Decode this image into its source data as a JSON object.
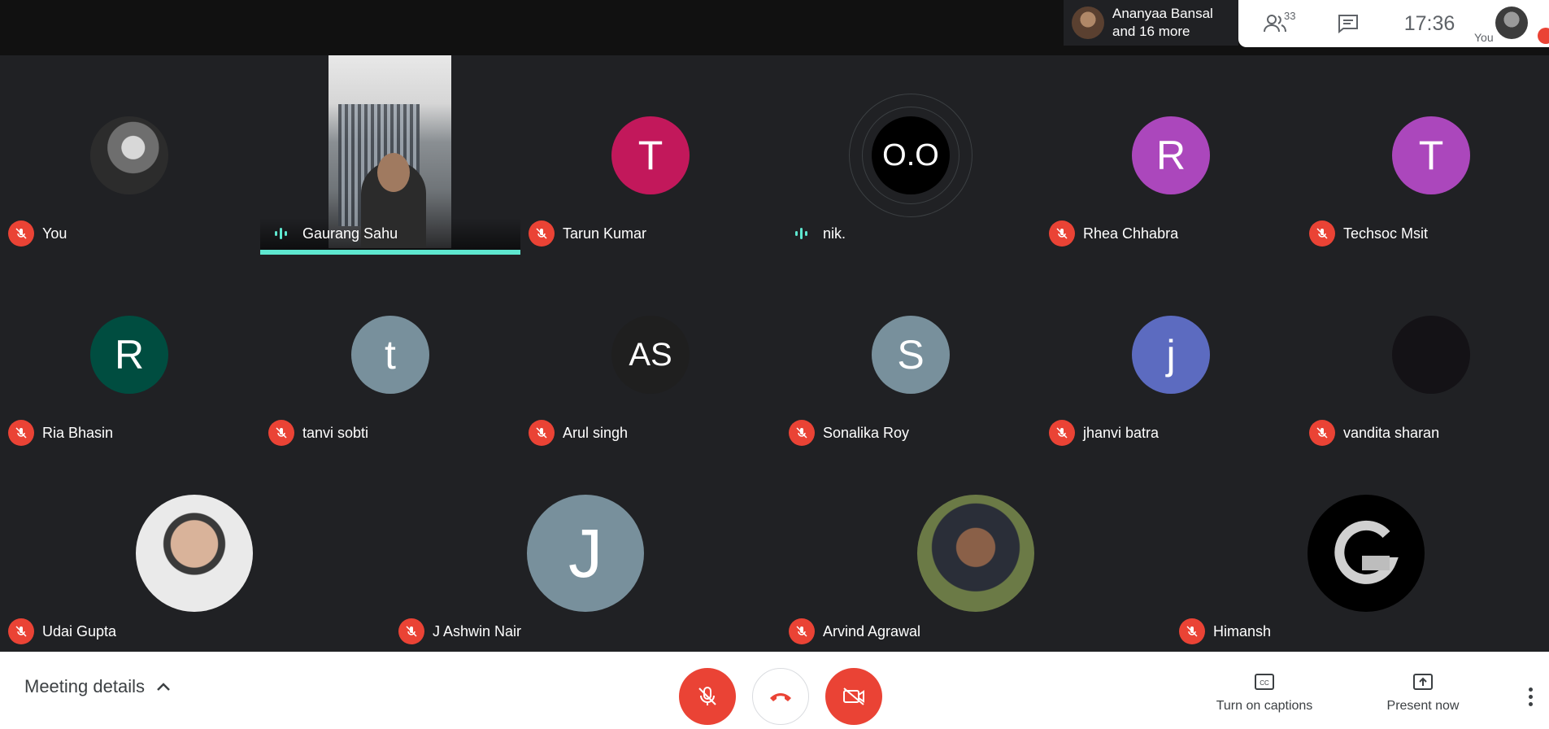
{
  "topbar": {
    "presence_text_line1": "Ananyaa Bansal",
    "presence_text_line2": "and 16 more",
    "people_count": "33",
    "clock": "17:36",
    "self_label": "You"
  },
  "participants": [
    {
      "name": "You",
      "initials": "",
      "muted": true,
      "color": "#555"
    },
    {
      "name": "Gaurang Sahu",
      "initials": "",
      "muted": false,
      "speaking": true
    },
    {
      "name": "Tarun Kumar",
      "initials": "T",
      "muted": true,
      "color": "#c2185b"
    },
    {
      "name": "nik.",
      "initials": "O.O",
      "muted": false,
      "speaking": true,
      "color": "#000000"
    },
    {
      "name": "Rhea Chhabra",
      "initials": "R",
      "muted": true,
      "color": "#ab47bc"
    },
    {
      "name": "Techsoc Msit",
      "initials": "T",
      "muted": true,
      "color": "#ab47bc"
    },
    {
      "name": "Ria Bhasin",
      "initials": "R",
      "muted": true,
      "color": "#004d40"
    },
    {
      "name": "tanvi sobti",
      "initials": "t",
      "muted": true,
      "color": "#78909c"
    },
    {
      "name": "Arul singh",
      "initials": "AS",
      "muted": true,
      "color": "#1f1f1f"
    },
    {
      "name": "Sonalika Roy",
      "initials": "S",
      "muted": true,
      "color": "#78909c"
    },
    {
      "name": "jhanvi batra",
      "initials": "j",
      "muted": true,
      "color": "#5c6bc0"
    },
    {
      "name": "vandita sharan",
      "initials": "",
      "muted": true,
      "color": "#141216"
    },
    {
      "name": "Udai Gupta",
      "initials": "",
      "muted": true,
      "color": "#c9c2b8"
    },
    {
      "name": "J Ashwin Nair",
      "initials": "J",
      "muted": true,
      "color": "#78909c"
    },
    {
      "name": "Arvind Agrawal",
      "initials": "",
      "muted": true,
      "color": "#5b6a3c"
    },
    {
      "name": "Himansh",
      "initials": "",
      "muted": true,
      "color": "#000000"
    }
  ],
  "bottombar": {
    "meeting_details": "Meeting details",
    "captions_label": "Turn on captions",
    "present_label": "Present now"
  }
}
